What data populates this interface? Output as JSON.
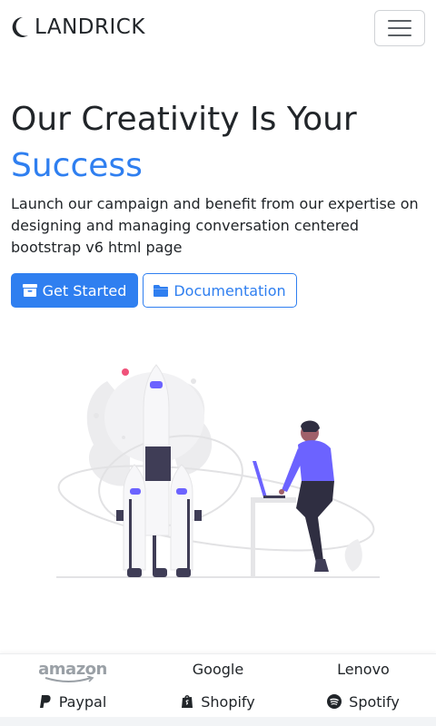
{
  "navbar": {
    "brand": "LANDRICK",
    "brand_icon": "moon-icon",
    "toggler_icon": "hamburger-menu-icon"
  },
  "hero": {
    "title": "Our Creativity Is Your",
    "title_accent": "Success",
    "description": "Launch our campaign and benefit from our expertise on designing and managing conversation centered bootstrap v6 html page",
    "primary_button": "Get Started",
    "primary_button_icon": "archive-box-icon",
    "secondary_button": "Documentation",
    "secondary_button_icon": "folder-icon"
  },
  "brands": {
    "items": [
      {
        "label": "amazon",
        "icon": "amazon-logo"
      },
      {
        "label": "Google"
      },
      {
        "label": "Lenovo"
      },
      {
        "label": "Paypal",
        "icon": "paypal-icon"
      },
      {
        "label": "Shopify",
        "icon": "shopify-icon"
      },
      {
        "label": "Spotify",
        "icon": "spotify-icon"
      }
    ]
  },
  "colors": {
    "accent": "#2f7ff0",
    "illustration_purple": "#6c63ff",
    "illustration_pink": "#f0527a"
  }
}
